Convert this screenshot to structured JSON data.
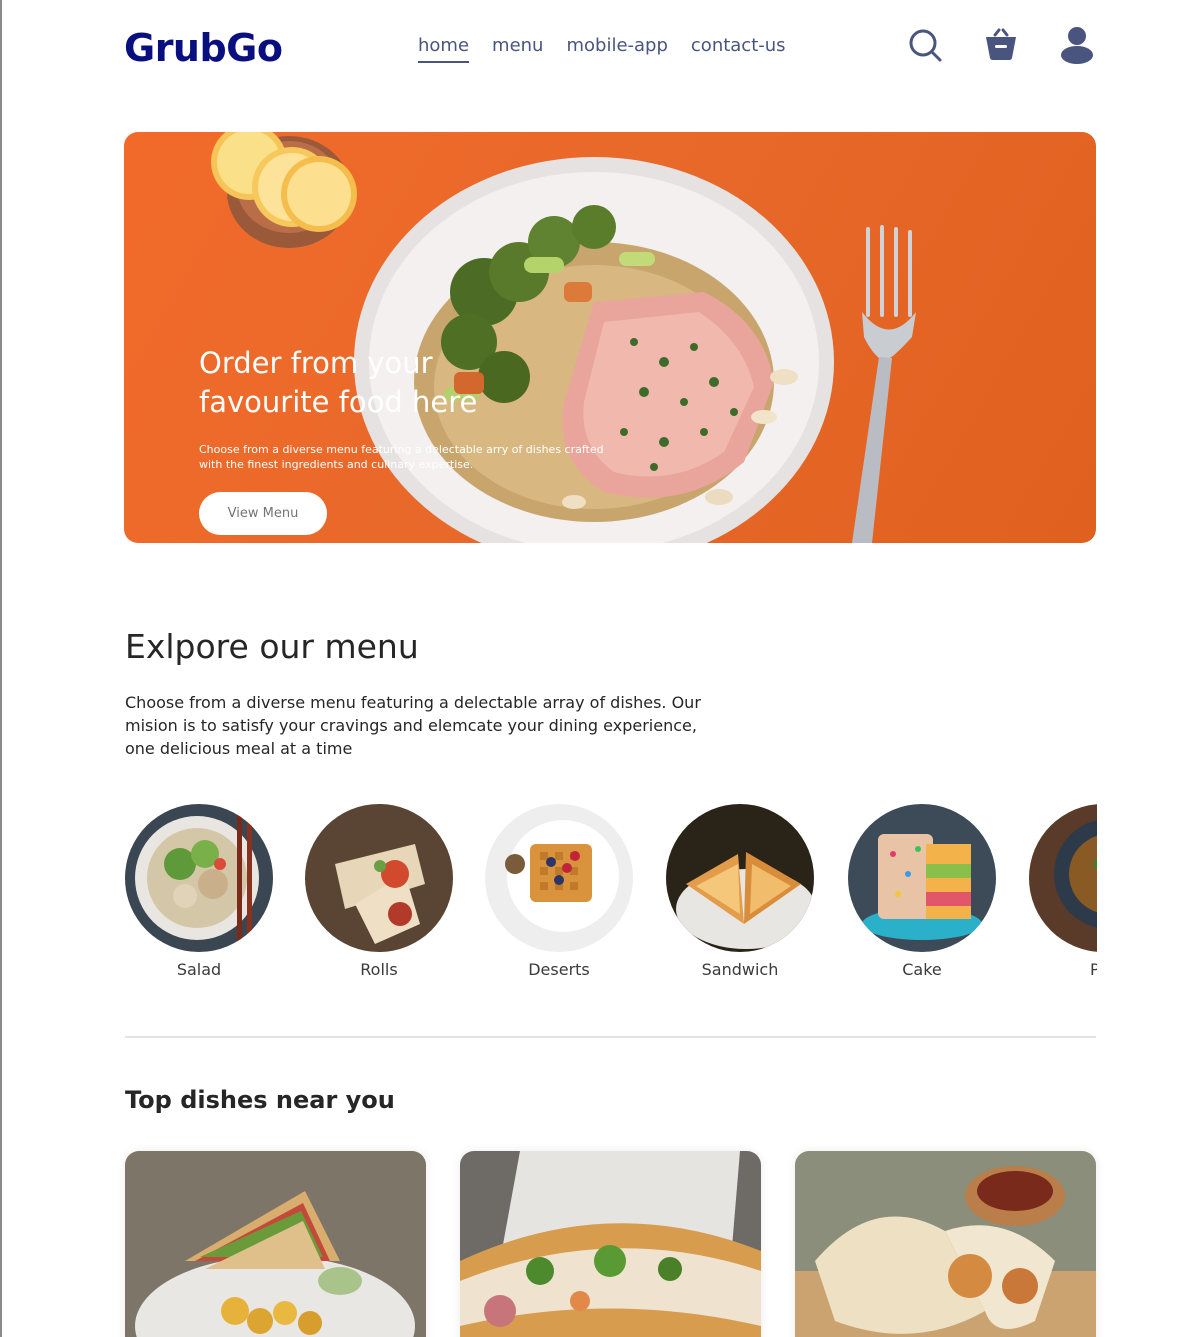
{
  "brand": {
    "logo": "GrubGo",
    "color": "#0a0f80"
  },
  "nav": {
    "links": [
      "home",
      "menu",
      "mobile-app",
      "contact-us"
    ],
    "active": "home",
    "icons": [
      "search-icon",
      "basket-icon",
      "profile-icon"
    ]
  },
  "hero": {
    "title": "Order from your\nfavourite food here",
    "text": "Choose from a diverse menu featuring a delectable arry of dishes crafted with the finest ingredients and culinary expertise.",
    "button": "View Menu"
  },
  "explore": {
    "title": "Exlpore our menu",
    "text": "Choose from a diverse menu featuring a delectable array of dishes. Our mision is to satisfy your cravings and elemcate your dining experience, one delicious meal at a time",
    "items": [
      "Salad",
      "Rolls",
      "Deserts",
      "Sandwich",
      "Cake",
      "Pur"
    ]
  },
  "top_dishes": {
    "title": "Top dishes near you"
  },
  "colors": {
    "accent": "#e8692a",
    "nav_text": "#49557e",
    "white": "#ffffff"
  }
}
